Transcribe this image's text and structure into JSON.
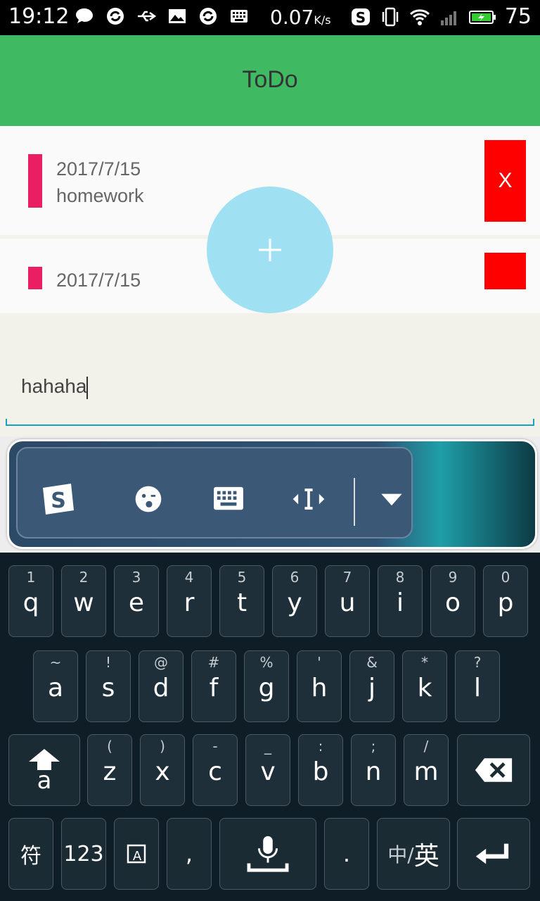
{
  "status_bar": {
    "time": "19:12",
    "speed": "0.07",
    "speed_unit": "K/s",
    "battery_percent": "75",
    "icons": [
      "message-icon",
      "sync-icon",
      "usb-icon",
      "image-icon",
      "sync-icon",
      "keyboard-icon",
      "sogou-icon",
      "vibrate-icon",
      "wifi-icon",
      "signal-icon",
      "battery-charging-icon"
    ]
  },
  "app_bar": {
    "title": "ToDo"
  },
  "todos": [
    {
      "date": "2017/7/15",
      "text": "homework",
      "delete_label": "X"
    },
    {
      "date": "2017/7/15",
      "text": "",
      "delete_label": ""
    }
  ],
  "fab": {
    "icon": "plus-icon"
  },
  "input": {
    "value": "hahaha"
  },
  "keyboard_toolbar": {
    "icons": [
      "sogou-logo-icon",
      "emoji-icon",
      "keyboard-icon",
      "cursor-icon",
      "chevron-down-icon"
    ]
  },
  "keyboard": {
    "row1": [
      {
        "sup": "1",
        "key": "q"
      },
      {
        "sup": "2",
        "key": "w"
      },
      {
        "sup": "3",
        "key": "e"
      },
      {
        "sup": "4",
        "key": "r"
      },
      {
        "sup": "5",
        "key": "t"
      },
      {
        "sup": "6",
        "key": "y"
      },
      {
        "sup": "7",
        "key": "u"
      },
      {
        "sup": "8",
        "key": "i"
      },
      {
        "sup": "9",
        "key": "o"
      },
      {
        "sup": "0",
        "key": "p"
      }
    ],
    "row2": [
      {
        "sup": "~",
        "key": "a"
      },
      {
        "sup": "!",
        "key": "s"
      },
      {
        "sup": "@",
        "key": "d"
      },
      {
        "sup": "#",
        "key": "f"
      },
      {
        "sup": "%",
        "key": "g"
      },
      {
        "sup": "'",
        "key": "h"
      },
      {
        "sup": "&",
        "key": "j"
      },
      {
        "sup": "*",
        "key": "k"
      },
      {
        "sup": "?",
        "key": "l"
      }
    ],
    "row3": [
      {
        "sup": "(",
        "key": "z"
      },
      {
        "sup": ")",
        "key": "x"
      },
      {
        "sup": "-",
        "key": "c"
      },
      {
        "sup": "_",
        "key": "v"
      },
      {
        "sup": ":",
        "key": "b"
      },
      {
        "sup": ";",
        "key": "n"
      },
      {
        "sup": "/",
        "key": "m"
      }
    ],
    "shift_label": "a",
    "symbols_label": "符",
    "numbers_label": "123",
    "comma_label": ",",
    "period_label": ".",
    "lang_label_zh": "中/",
    "lang_label_en": "英"
  }
}
